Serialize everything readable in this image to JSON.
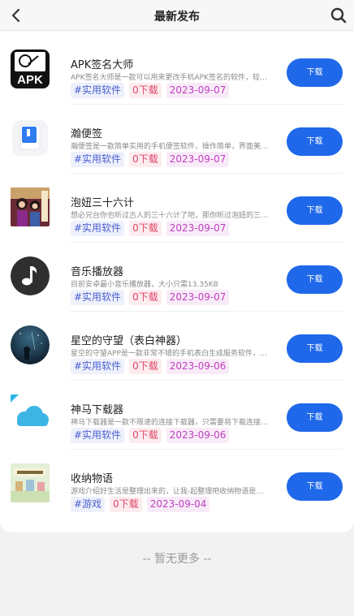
{
  "header": {
    "title": "最新发布",
    "back_icon": "chevron-left-icon",
    "search_icon": "search-icon"
  },
  "apps": [
    {
      "name": "APK签名大师",
      "desc": "APK签名大师是一款可以用来更改手机APK签名的软件，较…",
      "category": "#实用软件",
      "downloads": "0下载",
      "date": "2023-09-07",
      "button": "下载",
      "icon": "apk-icon"
    },
    {
      "name": "瀚便签",
      "desc": "瀚便签是一款简单实用的手机便签软件，操作简单，界面美…",
      "category": "#实用软件",
      "downloads": "0下载",
      "date": "2023-09-07",
      "button": "下载",
      "icon": "note-icon"
    },
    {
      "name": "泡妞三十六计",
      "desc": "想必兄台你也听过古人的三十六计了吧，那你听过泡妞的三…",
      "category": "#实用软件",
      "downloads": "0下载",
      "date": "2023-09-07",
      "button": "下载",
      "icon": "book-cover-icon"
    },
    {
      "name": "音乐播放器",
      "desc": "目前安卓最小音乐播放器，大小只需13.35KB",
      "category": "#实用软件",
      "downloads": "0下载",
      "date": "2023-09-07",
      "button": "下载",
      "icon": "music-note-icon"
    },
    {
      "name": "星空的守望（表白神器）",
      "desc": "星空的守望APP是一款非常不错的手机表白生成服务软件，…",
      "category": "#实用软件",
      "downloads": "0下载",
      "date": "2023-09-06",
      "button": "下载",
      "icon": "starry-sky-icon"
    },
    {
      "name": "神马下载器",
      "desc": "神马下载器是一款不限速的连接下载器，只需要将下载连接…",
      "category": "#实用软件",
      "downloads": "0下载",
      "date": "2023-09-06",
      "button": "下载",
      "icon": "cloud-icon"
    },
    {
      "name": "收纳物语",
      "desc": "游戏介绍好生活是整理出来的，让我-起整理吧收纳物语是…",
      "category": "#游戏",
      "downloads": "0下载",
      "date": "2023-09-04",
      "button": "下载",
      "icon": "game-cover-icon"
    }
  ],
  "footer": {
    "text": "-- 暂无更多 --"
  },
  "colors": {
    "accent": "#1f68ea",
    "category": "#4a5fd0",
    "downloads": "#e0486a",
    "date": "#c040c0"
  }
}
